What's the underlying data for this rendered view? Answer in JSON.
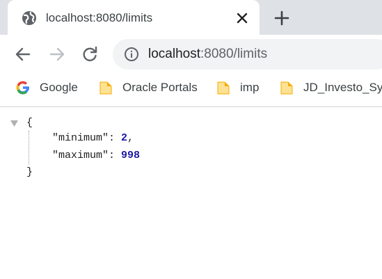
{
  "tab": {
    "title": "localhost:8080/limits"
  },
  "omnibox": {
    "host": "localhost",
    "path": ":8080/limits"
  },
  "bookmarks": [
    {
      "label": "Google",
      "icon": "google-g-icon"
    },
    {
      "label": "Oracle Portals",
      "icon": "folder-icon"
    },
    {
      "label": "imp",
      "icon": "folder-icon"
    },
    {
      "label": "JD_Investo_Sys",
      "icon": "folder-icon"
    }
  ],
  "json_view": {
    "open_brace": "{",
    "close_brace": "}",
    "fields": [
      {
        "key": "\"minimum\"",
        "colon": ": ",
        "value": "2",
        "trailing": ","
      },
      {
        "key": "\"maximum\"",
        "colon": ": ",
        "value": "998",
        "trailing": ""
      }
    ]
  }
}
